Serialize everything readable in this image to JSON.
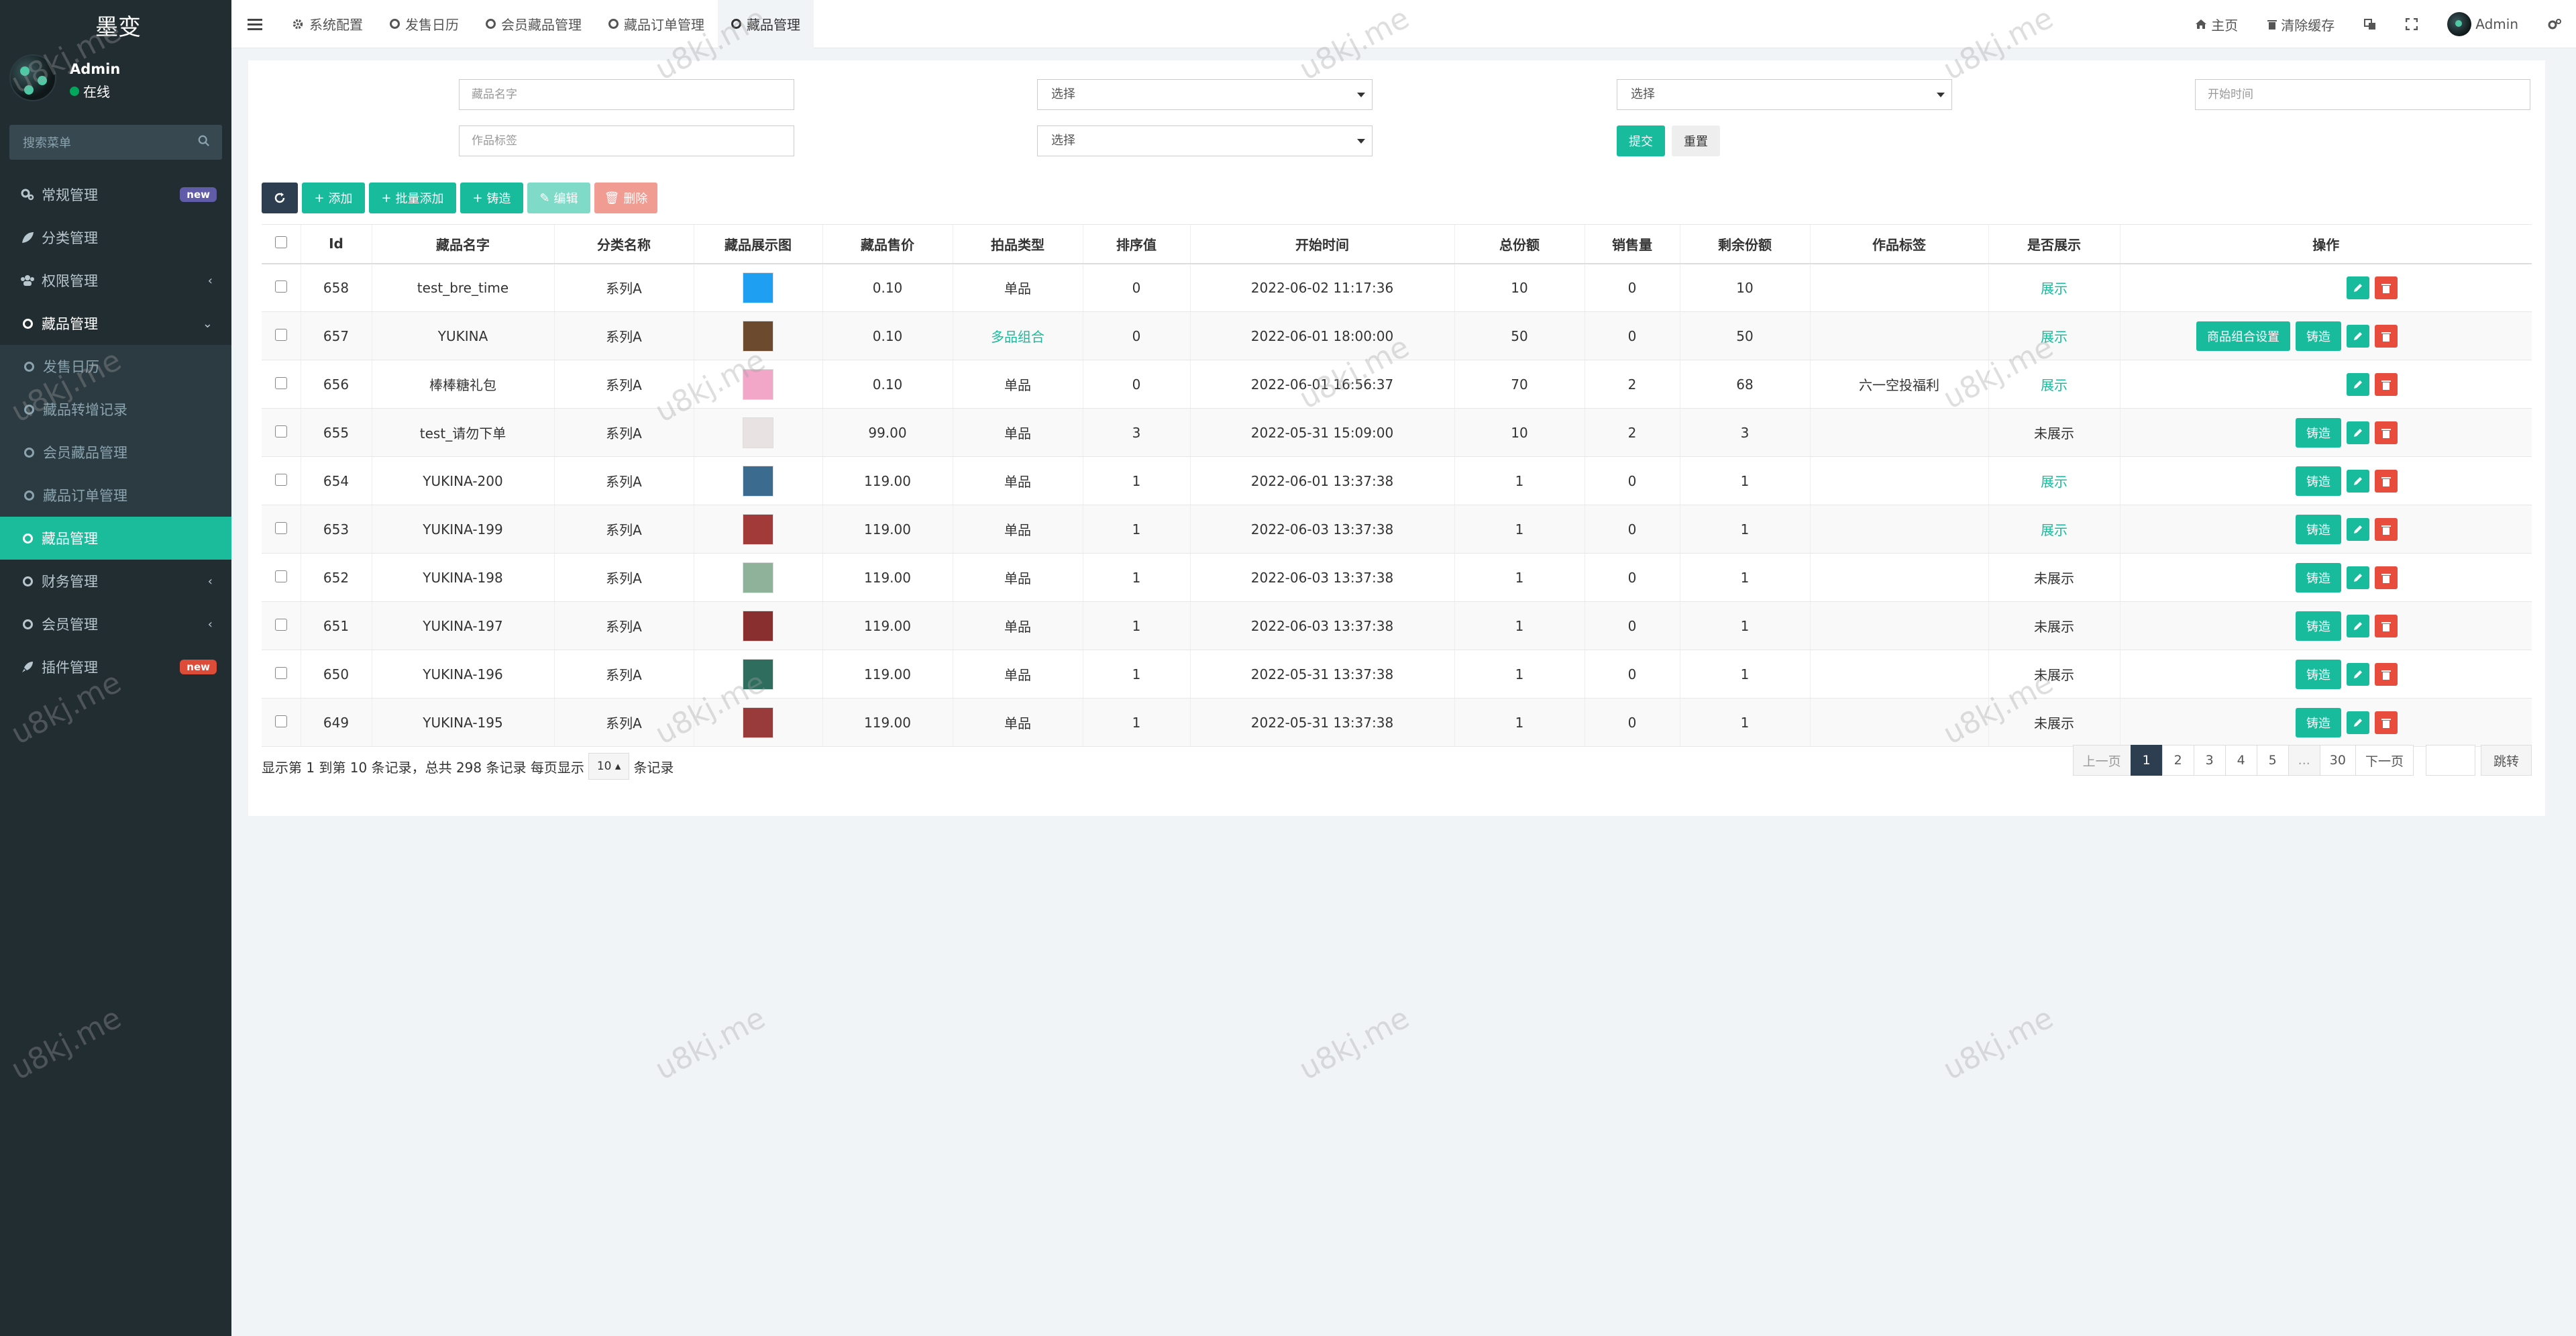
{
  "app": {
    "title": "墨变"
  },
  "user": {
    "name": "Admin",
    "status": "在线"
  },
  "sidebar": {
    "search_placeholder": "搜索菜单",
    "items": [
      {
        "label": "常规管理",
        "badge": "new",
        "badge_color": "#605ca8"
      },
      {
        "label": "分类管理"
      },
      {
        "label": "权限管理",
        "chevron": "‹"
      },
      {
        "label": "藏品管理",
        "chevron": "⌄"
      },
      {
        "label": "发售日历"
      },
      {
        "label": "藏品转增记录"
      },
      {
        "label": "会员藏品管理"
      },
      {
        "label": "藏品订单管理"
      },
      {
        "label": "藏品管理"
      },
      {
        "label": "财务管理",
        "chevron": "‹"
      },
      {
        "label": "会员管理",
        "chevron": "‹"
      },
      {
        "label": "插件管理",
        "badge": "new",
        "badge_color": "#dd4b39"
      }
    ]
  },
  "topbar": {
    "tabs": [
      "系统配置",
      "发售日历",
      "会员藏品管理",
      "藏品订单管理",
      "藏品管理"
    ],
    "home": "主页",
    "clear_cache": "清除缓存",
    "user": "Admin"
  },
  "filters": {
    "name_label": "藏品名字",
    "name_placeholder": "藏品名字",
    "category_label": "分类名称",
    "category_value": "选择",
    "auction_label": "拍品类型",
    "auction_value": "选择",
    "start_label": "开始时间",
    "start_placeholder": "开始时间",
    "tag_label": "作品标签",
    "tag_placeholder": "作品标签",
    "show_label": "是否展示",
    "show_value": "选择",
    "submit": "提交",
    "reset": "重置"
  },
  "toolbar": {
    "add": "添加",
    "batch_add": "批量添加",
    "mint": "铸造",
    "edit": "编辑",
    "delete": "删除"
  },
  "table": {
    "headers": [
      "Id",
      "藏品名字",
      "分类名称",
      "藏品展示图",
      "藏品售价",
      "拍品类型",
      "排序值",
      "开始时间",
      "总份额",
      "销售量",
      "剩余份额",
      "作品标签",
      "是否展示",
      "操作"
    ],
    "rows": [
      {
        "id": "658",
        "name": "test_bre_time",
        "cat": "系列A",
        "thumb": "#1e9ff2",
        "price": "0.10",
        "type": "单品",
        "sort": "0",
        "start": "2022-06-02 11:17:36",
        "total": "10",
        "sold": "0",
        "left": "10",
        "tag": "",
        "show": "展示",
        "ops": []
      },
      {
        "id": "657",
        "name": "YUKINA",
        "cat": "系列A",
        "thumb": "#6b4a2e",
        "price": "0.10",
        "type": "多品组合",
        "sort": "0",
        "start": "2022-06-01 18:00:00",
        "total": "50",
        "sold": "0",
        "left": "50",
        "tag": "",
        "show": "展示",
        "ops": [
          "商品组合设置",
          "铸造"
        ]
      },
      {
        "id": "656",
        "name": "棒棒糖礼包",
        "cat": "系列A",
        "thumb": "#f2a6c8",
        "price": "0.10",
        "type": "单品",
        "sort": "0",
        "start": "2022-06-01 16:56:37",
        "total": "70",
        "sold": "2",
        "left": "68",
        "tag": "六一空投福利",
        "show": "展示",
        "ops": []
      },
      {
        "id": "655",
        "name": "test_请勿下单",
        "cat": "系列A",
        "thumb": "#e8e2e2",
        "price": "99.00",
        "type": "单品",
        "sort": "3",
        "start": "2022-05-31 15:09:00",
        "total": "10",
        "sold": "2",
        "left": "3",
        "tag": "",
        "show": "未展示",
        "ops": [
          "铸造"
        ]
      },
      {
        "id": "654",
        "name": "YUKINA-200",
        "cat": "系列A",
        "thumb": "#3b6b8f",
        "price": "119.00",
        "type": "单品",
        "sort": "1",
        "start": "2022-06-01 13:37:38",
        "total": "1",
        "sold": "0",
        "left": "1",
        "tag": "",
        "show": "展示",
        "ops": [
          "铸造"
        ]
      },
      {
        "id": "653",
        "name": "YUKINA-199",
        "cat": "系列A",
        "thumb": "#a33a3a",
        "price": "119.00",
        "type": "单品",
        "sort": "1",
        "start": "2022-06-03 13:37:38",
        "total": "1",
        "sold": "0",
        "left": "1",
        "tag": "",
        "show": "展示",
        "ops": [
          "铸造"
        ]
      },
      {
        "id": "652",
        "name": "YUKINA-198",
        "cat": "系列A",
        "thumb": "#8fb39a",
        "price": "119.00",
        "type": "单品",
        "sort": "1",
        "start": "2022-06-03 13:37:38",
        "total": "1",
        "sold": "0",
        "left": "1",
        "tag": "",
        "show": "未展示",
        "ops": [
          "铸造"
        ]
      },
      {
        "id": "651",
        "name": "YUKINA-197",
        "cat": "系列A",
        "thumb": "#8a2f2f",
        "price": "119.00",
        "type": "单品",
        "sort": "1",
        "start": "2022-06-03 13:37:38",
        "total": "1",
        "sold": "0",
        "left": "1",
        "tag": "",
        "show": "未展示",
        "ops": [
          "铸造"
        ]
      },
      {
        "id": "650",
        "name": "YUKINA-196",
        "cat": "系列A",
        "thumb": "#2f6d5e",
        "price": "119.00",
        "type": "单品",
        "sort": "1",
        "start": "2022-05-31 13:37:38",
        "total": "1",
        "sold": "0",
        "left": "1",
        "tag": "",
        "show": "未展示",
        "ops": [
          "铸造"
        ]
      },
      {
        "id": "649",
        "name": "YUKINA-195",
        "cat": "系列A",
        "thumb": "#9a3b3b",
        "price": "119.00",
        "type": "单品",
        "sort": "1",
        "start": "2022-05-31 13:37:38",
        "total": "1",
        "sold": "0",
        "left": "1",
        "tag": "",
        "show": "未展示",
        "ops": [
          "铸造"
        ]
      }
    ]
  },
  "pagination": {
    "info": "显示第 1 到第 10 条记录，总共 298 条记录 每页显示",
    "page_size": "10",
    "suffix": "条记录",
    "prev": "上一页",
    "pages": [
      "1",
      "2",
      "3",
      "4",
      "5",
      "...",
      "30"
    ],
    "current": "1",
    "next": "下一页",
    "jump": "跳转"
  },
  "watermark": "u8kj.me",
  "colors": {
    "accent": "#18bc9c",
    "sidebar_bg": "#222d32",
    "danger": "#e74c3c",
    "dark": "#2c3e50"
  }
}
